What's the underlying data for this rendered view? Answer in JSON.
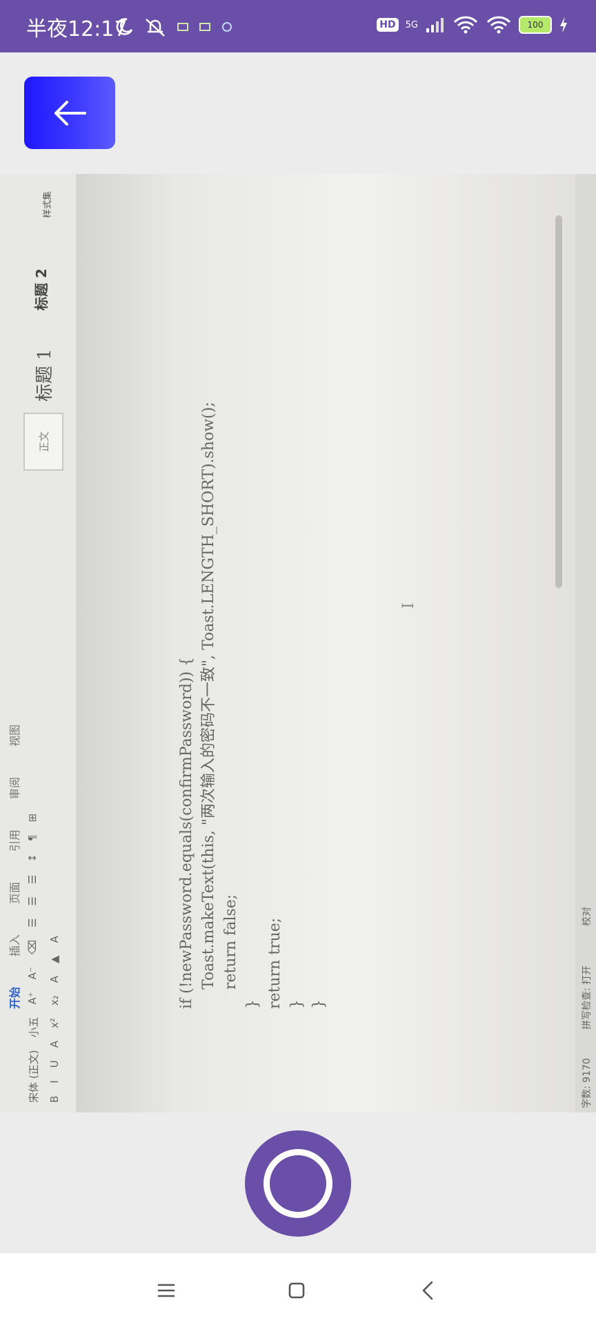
{
  "status_bar": {
    "time": "半夜12:17",
    "hd_badge": "HD",
    "network": "5G",
    "battery": "100"
  },
  "camera": {
    "back_label": "Back"
  },
  "preview": {
    "ribbon": {
      "tabs": [
        "开始",
        "插入",
        "页面",
        "引用",
        "审阅",
        "视图"
      ],
      "row1": [
        "宋体 (正文)",
        "小五",
        "A⁺",
        "A⁻",
        "⌫",
        "☰",
        "☰",
        "☰",
        "↕",
        "¶",
        "⊞"
      ],
      "row2": [
        "B",
        "I",
        "U",
        "A",
        "x²",
        "x₂",
        "A",
        "▲",
        "A"
      ],
      "style_normal": "正文",
      "style_h1": "标题 1",
      "style_h2": "标题 2",
      "style_set": "样式集"
    },
    "code_lines": [
      "if (!newPassword.equals(confirmPassword)) {",
      "    Toast.makeText(this, \"两次输入的密码不一致\", Toast.LENGTH_SHORT).show();",
      "    return false;",
      "}",
      "return true;",
      "}",
      "}"
    ],
    "cursor": "I",
    "status": {
      "word_count": "字数: 9170",
      "spell_check": "拼写检查: 打开",
      "proof": "校对"
    }
  }
}
